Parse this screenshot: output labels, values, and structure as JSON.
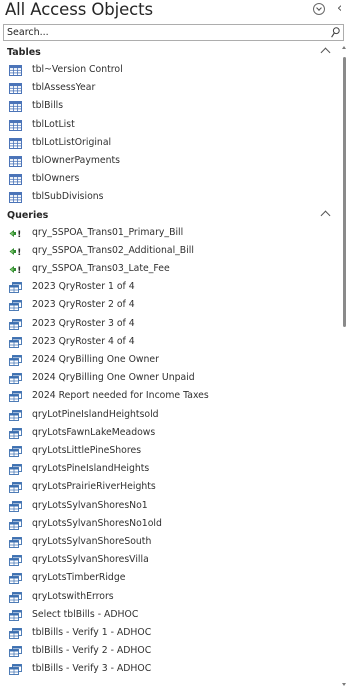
{
  "header": {
    "title": "All Access Objects",
    "menu_icon": "chevron-down-circle-icon",
    "collapse_icon": "chevron-left-icon",
    "collapse_glyph": "‹"
  },
  "search": {
    "placeholder": "Search...",
    "value": ""
  },
  "colors": {
    "table_icon": "#4b74b8",
    "query_icon": "#3c6fb0",
    "action_green": "#2f8a2f",
    "action_bang": "#2b2b2b"
  },
  "groups": [
    {
      "title": "Tables",
      "icon": "table-icon",
      "items": [
        {
          "label": "tbl~Version Control"
        },
        {
          "label": "tblAssessYear"
        },
        {
          "label": "tblBills"
        },
        {
          "label": "tblLotList"
        },
        {
          "label": "tblLotListOriginal"
        },
        {
          "label": "tblOwnerPayments"
        },
        {
          "label": "tblOwners"
        },
        {
          "label": "tblSubDivisions"
        }
      ]
    },
    {
      "title": "Queries",
      "icon": "query-icon",
      "items": [
        {
          "label": "qry_SSPOA_Trans01_Primary_Bill",
          "kind": "append"
        },
        {
          "label": "qry_SSPOA_Trans02_Additional_Bill",
          "kind": "append"
        },
        {
          "label": "qry_SSPOA_Trans03_Late_Fee",
          "kind": "append"
        },
        {
          "label": "2023 QryRoster 1 of 4",
          "kind": "select"
        },
        {
          "label": "2023 QryRoster 2 of 4",
          "kind": "select"
        },
        {
          "label": "2023 QryRoster 3 of 4",
          "kind": "select"
        },
        {
          "label": "2023 QryRoster 4 of 4",
          "kind": "select"
        },
        {
          "label": "2024 QryBilling One Owner",
          "kind": "select"
        },
        {
          "label": "2024 QryBilling One Owner Unpaid",
          "kind": "select"
        },
        {
          "label": "2024 Report needed for Income Taxes",
          "kind": "select"
        },
        {
          "label": "qryLotPineIslandHeightsold",
          "kind": "select"
        },
        {
          "label": "qryLotsFawnLakeMeadows",
          "kind": "select"
        },
        {
          "label": "qryLotsLittlePineShores",
          "kind": "select"
        },
        {
          "label": "qryLotsPineIslandHeights",
          "kind": "select"
        },
        {
          "label": "qryLotsPrairieRiverHeights",
          "kind": "select"
        },
        {
          "label": "qryLotsSylvanShoresNo1",
          "kind": "select"
        },
        {
          "label": "qryLotsSylvanShoresNo1old",
          "kind": "select"
        },
        {
          "label": "qryLotsSylvanShoreSouth",
          "kind": "select"
        },
        {
          "label": "qryLotsSylvanShoresVilla",
          "kind": "select"
        },
        {
          "label": "qryLotsTimberRidge",
          "kind": "select"
        },
        {
          "label": "qryLotswithErrors",
          "kind": "select"
        },
        {
          "label": "Select tblBills - ADHOC",
          "kind": "select"
        },
        {
          "label": "tblBills - Verify 1 - ADHOC",
          "kind": "select"
        },
        {
          "label": "tblBills - Verify 2 - ADHOC",
          "kind": "select"
        },
        {
          "label": "tblBills - Verify 3 - ADHOC",
          "kind": "select"
        }
      ]
    }
  ]
}
